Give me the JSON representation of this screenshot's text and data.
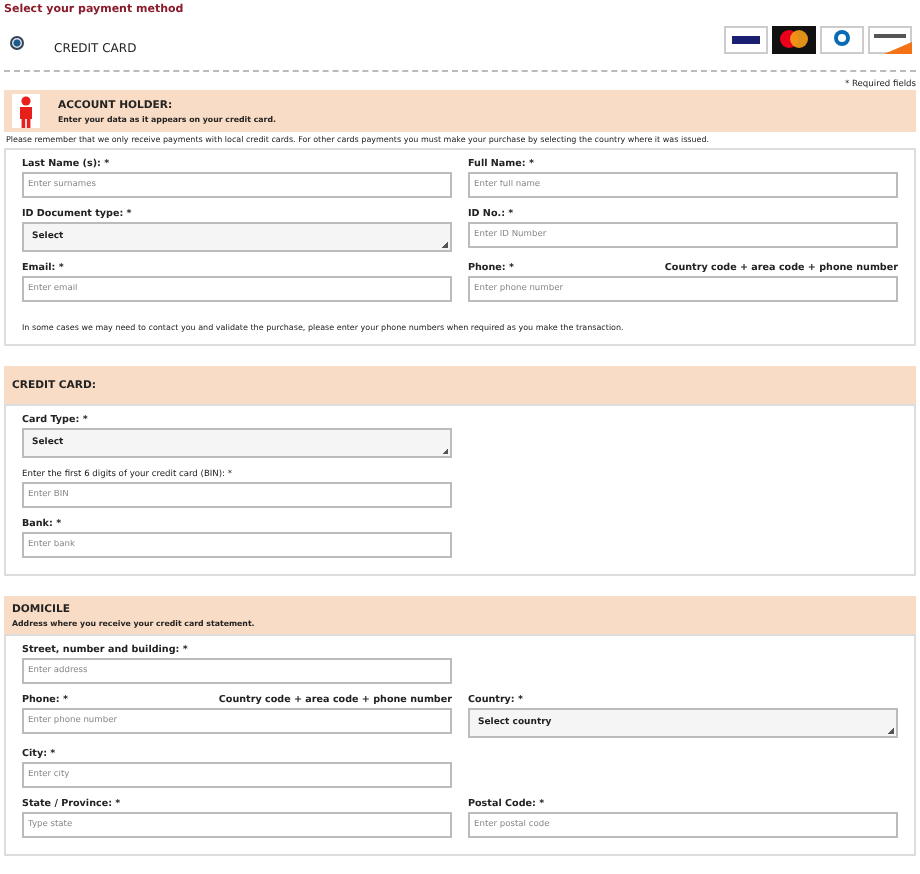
{
  "heading": "Select your payment method",
  "payment_option": {
    "label": "CREDIT CARD",
    "selected": true
  },
  "required_note": "* Required fields",
  "sections": [
    {
      "title": "ACCOUNT HOLDER:",
      "subtitle": "Enter your data as it appears on your credit card.",
      "note_above": "Please remember that we only receive payments with local credit cards. For other cards payments you must make your purchase by selecting the country where it was issued.",
      "rows": [
        [
          {
            "label": "Last Name (s): *",
            "kind": "input",
            "placeholder": "Enter surnames"
          },
          {
            "label": "Full Name: *",
            "kind": "input",
            "placeholder": "Enter full name"
          }
        ],
        [
          {
            "label": "ID Document type: *",
            "kind": "select",
            "value": "Select"
          },
          {
            "label": "ID No.: *",
            "kind": "input",
            "placeholder": "Enter ID Number"
          }
        ],
        [
          {
            "label": "Email: *",
            "kind": "input",
            "placeholder": "Enter email"
          },
          {
            "label": "Phone: *",
            "hint": "Country code + area code + phone number",
            "kind": "input",
            "placeholder": "Enter phone number"
          }
        ]
      ],
      "note_below": "In some cases we may need to contact you and validate the purchase, please enter your phone numbers when required as you make the transaction."
    },
    {
      "title": "CREDIT CARD:",
      "rows": [
        [
          {
            "label": "Card Type: *",
            "kind": "select",
            "value": "Select"
          },
          null
        ],
        [
          {
            "label": "Enter the first 6 digits of your credit card (BIN): *",
            "kind": "input",
            "placeholder": "Enter BIN"
          },
          null
        ],
        [
          {
            "label": "Bank: *",
            "kind": "input",
            "placeholder": "Enter bank"
          },
          null
        ]
      ]
    },
    {
      "title": "DOMICILE",
      "subtitle": "Address where you receive your credit card statement.",
      "rows": [
        [
          {
            "label": "Street, number and building: *",
            "kind": "input",
            "placeholder": "Enter address"
          },
          null
        ],
        [
          {
            "label": "Phone: *",
            "hint": "Country code + area code + phone number",
            "kind": "input",
            "placeholder": "Enter phone number"
          },
          {
            "label": "Country: *",
            "kind": "select",
            "value": "Select country"
          }
        ],
        [
          {
            "label": "City: *",
            "kind": "input",
            "placeholder": "Enter city"
          },
          null
        ],
        [
          {
            "label": "State / Province: *",
            "kind": "input",
            "placeholder": "Type state"
          },
          {
            "label": "Postal Code: *",
            "kind": "input",
            "placeholder": "Enter postal code"
          }
        ]
      ]
    }
  ]
}
